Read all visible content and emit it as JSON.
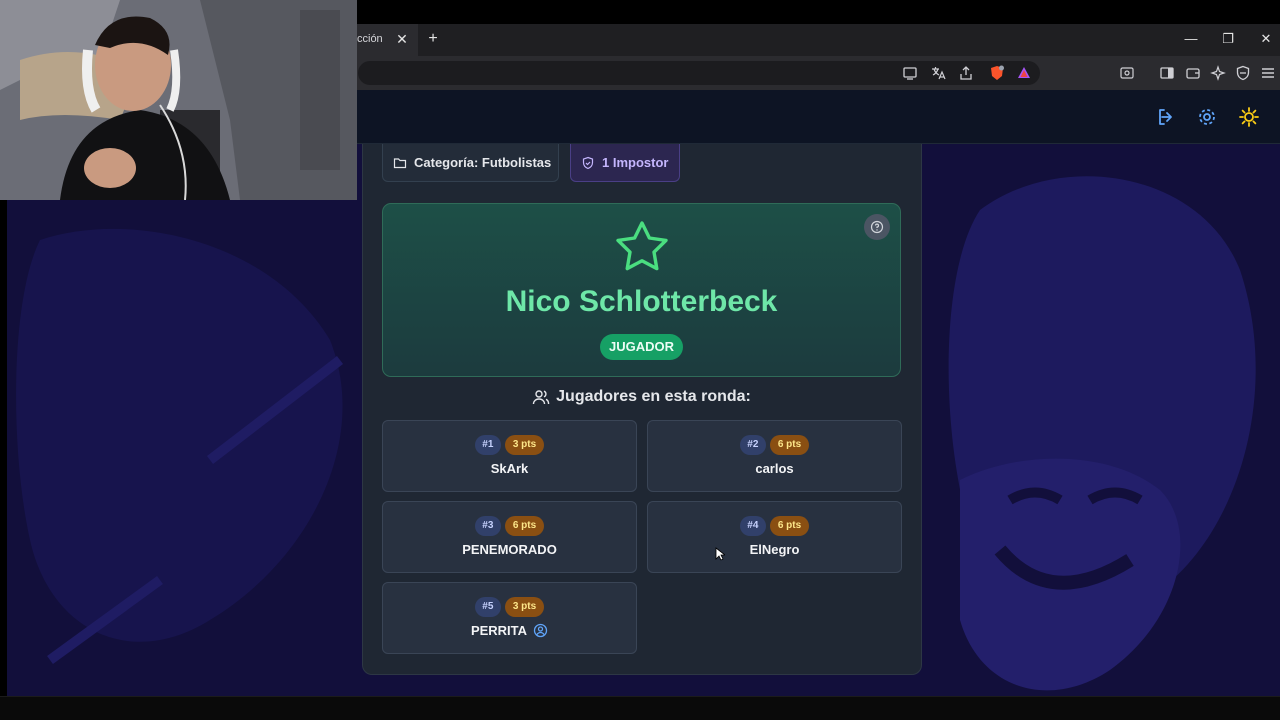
{
  "browser": {
    "tab_title": "cción",
    "tab_close": "✕",
    "new_tab": "+",
    "window_controls": {
      "minimize": "—",
      "restore": "❐",
      "close": "✕"
    }
  },
  "header": {
    "icons": [
      "logout-icon",
      "gear-icon",
      "sun-icon"
    ]
  },
  "game": {
    "category": "Categoría: Futbolistas",
    "impostors": "1 Impostor",
    "role_card": {
      "word": "Nico Schlotterbeck",
      "role": "JUGADOR"
    },
    "players_title": "Jugadores en esta ronda:",
    "players": [
      {
        "num": "#1",
        "pts": "3 pts",
        "name": "SkArk",
        "is_you": false
      },
      {
        "num": "#2",
        "pts": "6 pts",
        "name": "carlos",
        "is_you": false
      },
      {
        "num": "#3",
        "pts": "6 pts",
        "name": "PENEMORADO",
        "is_you": false
      },
      {
        "num": "#4",
        "pts": "6 pts",
        "name": "ElNegro",
        "is_you": false
      },
      {
        "num": "#5",
        "pts": "3 pts",
        "name": "PERRITA",
        "is_you": true
      }
    ]
  },
  "colors": {
    "accent_green": "#6ee7a8",
    "role_badge": "#16a065",
    "points_badge": "#8a4f12",
    "background": "#120f3b"
  }
}
